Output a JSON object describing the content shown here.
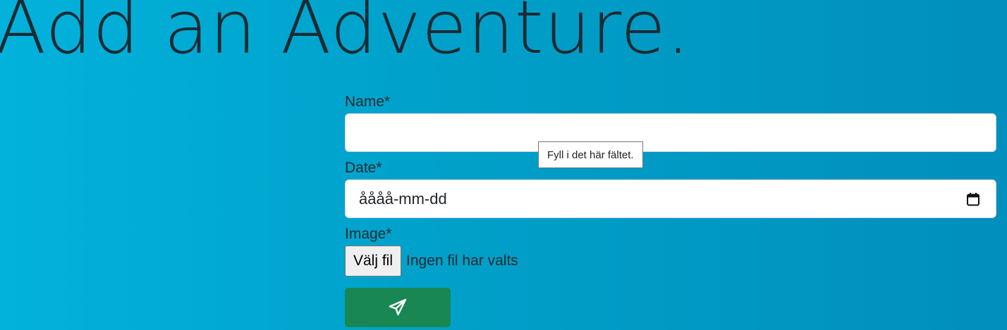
{
  "page": {
    "title": "Add an Adventure."
  },
  "form": {
    "name_label": "Name*",
    "name_value": "",
    "date_label": "Date*",
    "date_placeholder": "åååå-mm-dd",
    "image_label": "Image*",
    "file_button_label": "Välj fil",
    "file_status": "Ingen fil har valts",
    "submit_icon": "send-icon"
  },
  "tooltip": {
    "text": "Fyll i det här fältet."
  },
  "colors": {
    "background_start": "#02b2db",
    "background_end": "#018fbd",
    "submit": "#198754"
  }
}
